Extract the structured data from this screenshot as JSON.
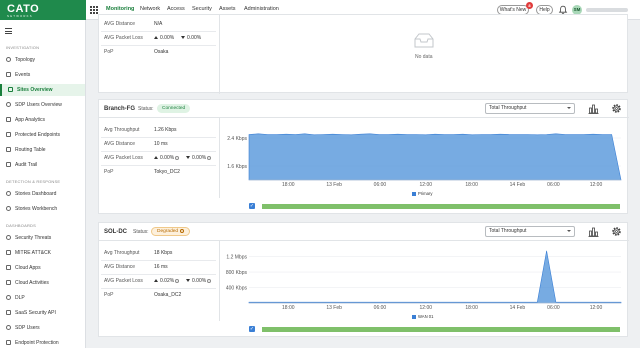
{
  "app": {
    "logo": "CATO",
    "logo_sub": "NETWORKS",
    "nav": [
      "Monitoring",
      "Network",
      "Access",
      "Security",
      "Assets",
      "Administration"
    ],
    "whats_new": "What's New",
    "whats_new_count": "8",
    "help": "Help",
    "user_initials": "SM"
  },
  "sidebar": {
    "sections": [
      {
        "title": "INVESTIGATION",
        "items": [
          "Topology",
          "Events",
          "Sites Overview",
          "SDP Users Overview",
          "App Analytics",
          "Protected Endpoints",
          "Routing Table",
          "Audit Trail"
        ]
      },
      {
        "title": "DETECTION & RESPONSE",
        "items": [
          "Stories Dashboard",
          "Stories Workbench"
        ]
      },
      {
        "title": "DASHBOARDS",
        "items": [
          "Security Threats",
          "MITRE ATT&CK",
          "Cloud Apps",
          "Cloud Activities",
          "DLP",
          "SaaS Security API",
          "SDP Users",
          "Endpoint Protection"
        ]
      }
    ],
    "active": "Sites Overview"
  },
  "top_panel": {
    "rows": [
      {
        "label": "AVG Distance",
        "value": "N/A"
      },
      {
        "label": "AVG Packet Loss",
        "up": "0.00",
        "down": "0.00",
        "unit": "%"
      },
      {
        "label": "PoP",
        "value": "Osaka"
      }
    ],
    "no_data": "No data"
  },
  "sites": [
    {
      "name": "Branch-FG",
      "status_label": "Status:",
      "status": "Connected",
      "select": "Total Throughput",
      "rows": [
        {
          "label": "Avg Throughput",
          "value": "1.26 Kbps"
        },
        {
          "label": "AVG Distance",
          "value": "10 ms"
        },
        {
          "label": "AVG Packet Loss",
          "up": "0.00",
          "down": "0.00",
          "unit": "%"
        },
        {
          "label": "PoP",
          "value": "Tokyo_DC2"
        }
      ],
      "chart_data": {
        "type": "area",
        "y_ticks": [
          "2.4 Kbps",
          "1.6 Kbps"
        ],
        "x_ticks": [
          "18:00",
          "13 Feb",
          "06:00",
          "12:00",
          "18:00",
          "14 Feb",
          "06:00",
          "12:00"
        ],
        "series": [
          {
            "name": "Primary",
            "color": "#4a8fd8",
            "values": [
              2.5,
              2.52,
              2.5,
              2.5,
              2.51,
              2.5,
              2.52,
              2.49,
              2.5,
              2.51,
              2.5,
              2.49,
              2.51,
              2.52,
              2.5,
              2.5,
              2.51,
              2.5,
              2.5,
              2.49,
              2.51,
              2.5,
              2.5,
              2.51,
              2.49,
              2.5,
              2.5,
              2.51,
              2.5,
              2.5,
              2.5,
              2.49,
              2.5,
              2.52,
              2.5,
              2.5,
              2.5,
              2.51,
              2.5,
              2.5,
              1.2
            ]
          }
        ],
        "ylim": [
          1.2,
          2.8
        ]
      }
    },
    {
      "name": "SOL-DC",
      "status_label": "Status:",
      "status": "Degraded",
      "select": "Total Throughput",
      "rows": [
        {
          "label": "Avg Throughput",
          "value": "18 Kbps"
        },
        {
          "label": "AVG Distance",
          "value": "16 ms"
        },
        {
          "label": "AVG Packet Loss",
          "up": "0.02",
          "down": "0.00",
          "unit": "%"
        },
        {
          "label": "PoP",
          "value": "Osaka_DC2"
        }
      ],
      "chart_data": {
        "type": "area",
        "y_ticks": [
          "1.2 Mbps",
          "800 Kbps",
          "400 Kbps"
        ],
        "x_ticks": [
          "18:00",
          "13 Feb",
          "06:00",
          "12:00",
          "18:00",
          "14 Feb",
          "06:00",
          "12:00"
        ],
        "series": [
          {
            "name": "WAN 01",
            "color": "#4a8fd8",
            "values": [
              0.02,
              0.02,
              0.02,
              0.02,
              0.02,
              0.02,
              0.02,
              0.02,
              0.02,
              0.02,
              0.02,
              0.02,
              0.02,
              0.02,
              0.02,
              0.02,
              0.02,
              0.02,
              0.02,
              0.02,
              0.02,
              0.02,
              0.02,
              0.02,
              0.02,
              0.02,
              0.02,
              0.02,
              0.02,
              0.02,
              0.02,
              0.02,
              1.35,
              0.02,
              0.02,
              0.02,
              0.02,
              0.02,
              0.02,
              0.02,
              0.02
            ]
          }
        ],
        "ylim": [
          0,
          1.45
        ]
      }
    }
  ]
}
